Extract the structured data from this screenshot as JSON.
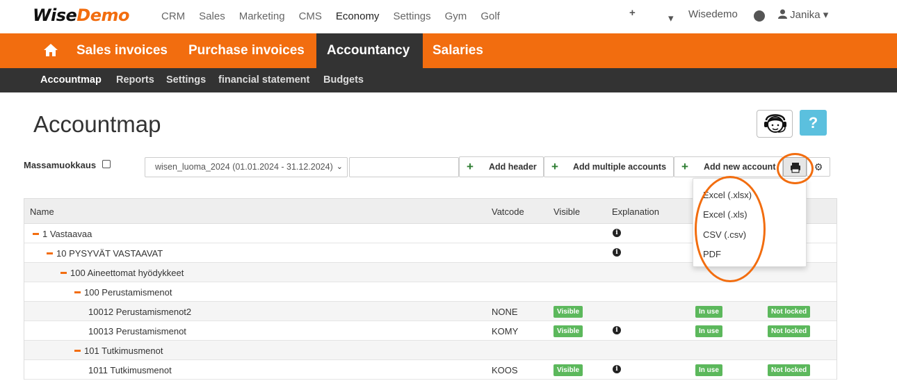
{
  "topnav": {
    "logo_wise": "Wise",
    "logo_demo": "Demo",
    "menu": [
      "CRM",
      "Sales",
      "Marketing",
      "CMS",
      "Economy",
      "Settings",
      "Gym",
      "Golf"
    ],
    "plus": "+",
    "caret": "▾",
    "company": "Wisedemo",
    "help": "?",
    "user": "Janika ▾"
  },
  "orangebar": {
    "tabs": [
      "Sales invoices",
      "Purchase invoices",
      "Accountancy",
      "Salaries"
    ]
  },
  "subnav": {
    "items": [
      "Accountmap",
      "Reports",
      "Settings",
      "financial statement",
      "Budgets"
    ]
  },
  "page": {
    "title": "Accountmap",
    "help": "?"
  },
  "toolbar": {
    "mass_label": "Massamuokkaus",
    "period": "wisen_luoma_2024 (01.01.2024 - 31.12.2024)",
    "period_chevron": "⌄",
    "plus": "+",
    "add_header": "Add header",
    "add_multiple": "Add multiple accounts",
    "add_new": "Add new account",
    "gear": "⚙"
  },
  "export_menu": [
    "Excel (.xlsx)",
    "Excel (.xls)",
    "CSV (.csv)",
    "PDF"
  ],
  "table": {
    "headers": {
      "name": "Name",
      "vatcode": "Vatcode",
      "visible": "Visible",
      "explanation": "Explanation"
    },
    "info": "i",
    "rows": [
      {
        "name": "1 Vastaavaa",
        "vat": "",
        "visible": "",
        "in_use": "",
        "locked": ""
      },
      {
        "name": "10 PYSYVÄT VASTAAVAT",
        "vat": "",
        "visible": "",
        "in_use": "",
        "locked": ""
      },
      {
        "name": "100 Aineettomat hyödykkeet",
        "vat": "",
        "visible": "",
        "in_use": "",
        "locked": ""
      },
      {
        "name": "100 Perustamismenot",
        "vat": "",
        "visible": "",
        "in_use": "",
        "locked": ""
      },
      {
        "name": "10012 Perustamismenot2",
        "vat": "NONE",
        "visible": "Visible",
        "in_use": "In use",
        "locked": "Not locked"
      },
      {
        "name": "10013 Perustamismenot",
        "vat": "KOMY",
        "visible": "Visible",
        "in_use": "In use",
        "locked": "Not locked"
      },
      {
        "name": "101 Tutkimusmenot",
        "vat": "",
        "visible": "",
        "in_use": "",
        "locked": ""
      },
      {
        "name": "1011 Tutkimusmenot",
        "vat": "KOOS",
        "visible": "Visible",
        "in_use": "In use",
        "locked": "Not locked"
      }
    ]
  }
}
